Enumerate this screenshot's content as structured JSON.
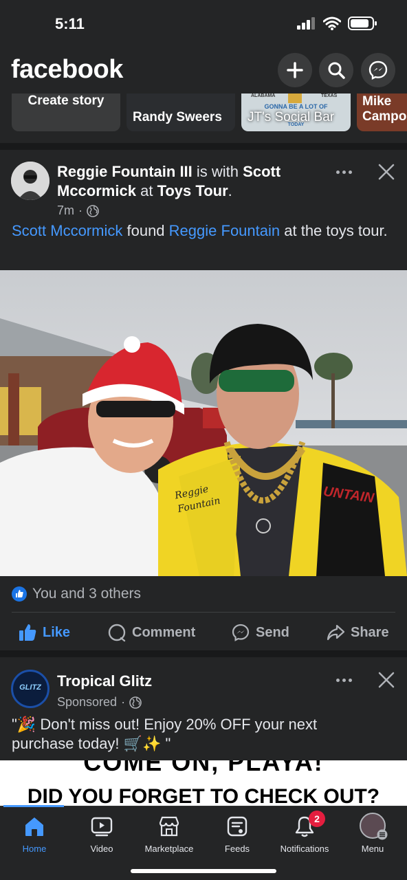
{
  "status": {
    "time": "5:11"
  },
  "header": {
    "logo": "facebook",
    "icons": [
      "plus-icon",
      "search-icon",
      "messenger-icon"
    ]
  },
  "stories": [
    {
      "label": "Create story"
    },
    {
      "label": "Randy Sweers"
    },
    {
      "label": "JT's Social Bar",
      "sign_lines": [
        "ALABAMA",
        "TEXAS",
        "GONNA BE A LOT OF",
        "TODAY"
      ]
    },
    {
      "label": "Mike Campol"
    }
  ],
  "post1": {
    "author": "Reggie Fountain III",
    "with_text": "is with",
    "tagged": "Scott Mccormick",
    "at_text": "at",
    "place": "Toys Tour",
    "time": "7m",
    "caption_link1": "Scott Mccormick",
    "caption_mid": "found",
    "caption_link2": "Reggie Fountain",
    "caption_end": "at the toys tour.",
    "photo": {
      "jacket_text_left": "Reggie Fountain",
      "jacket_text_right": "UNTAIN"
    },
    "reactions": "You and 3 others",
    "actions": {
      "like": "Like",
      "comment": "Comment",
      "send": "Send",
      "share": "Share"
    }
  },
  "post2": {
    "author": "Tropical Glitz",
    "avatar_text": "GLITZ",
    "sponsored": "Sponsored",
    "text": "\"🎉 Don't miss out! Enjoy 20% OFF your next purchase today! 🛒✨ \"",
    "banner_line1": "COME ON, PLAYA!",
    "banner_line2": "DID YOU FORGET TO CHECK OUT?"
  },
  "tabs": [
    {
      "label": "Home",
      "active": true
    },
    {
      "label": "Video"
    },
    {
      "label": "Marketplace"
    },
    {
      "label": "Feeds"
    },
    {
      "label": "Notifications",
      "badge": "2"
    },
    {
      "label": "Menu"
    }
  ],
  "colors": {
    "accent": "#4599ff",
    "background": "#242526",
    "separator": "#18191a",
    "badge": "#e41e3f"
  }
}
